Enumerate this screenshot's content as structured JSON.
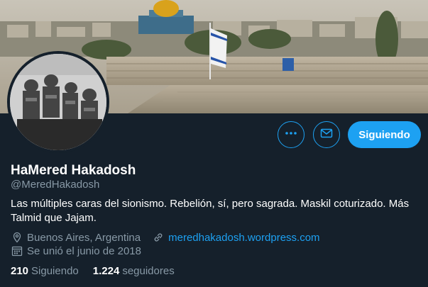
{
  "colors": {
    "background": "#15202b",
    "accent": "#1da1f2",
    "secondary_text": "#8899a6",
    "primary_text": "#ffffff"
  },
  "banner": {
    "icon": "jerusalem-old-city-photo"
  },
  "avatar": {
    "icon": "soldiers-photo"
  },
  "actions": {
    "more_icon": "more-dots-icon",
    "message_icon": "envelope-icon",
    "follow_label": "Siguiendo"
  },
  "profile": {
    "name": "HaMered Hakadosh",
    "handle": "@MeredHakadosh",
    "bio": "Las múltiples caras del sionismo. Rebelión, sí, pero sagrada. Maskil coturizado. Más Talmid que Jajam.",
    "location": "Buenos Aires, Argentina",
    "website": "meredhakadosh.wordpress.com",
    "joined": "Se unió el junio de 2018"
  },
  "stats": {
    "following_count": "210",
    "following_label": "Siguiendo",
    "followers_count": "1.224",
    "followers_label": "seguidores"
  }
}
